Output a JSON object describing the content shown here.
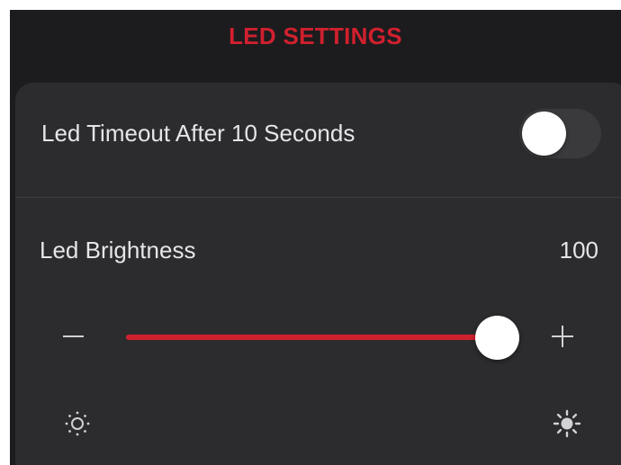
{
  "header": {
    "title": "LED SETTINGS"
  },
  "timeout_setting": {
    "label": "Led Timeout After 10 Seconds",
    "enabled": false
  },
  "brightness_setting": {
    "label": "Led Brightness",
    "value": "100",
    "level_fraction": 1.0,
    "min_icon": "sun-dim-icon",
    "max_icon": "sun-bright-icon",
    "decrease_icon": "minus-icon",
    "increase_icon": "plus-icon"
  },
  "colors": {
    "accent": "#d0202e",
    "background": "#1c1c1e",
    "card": "#2c2c2e"
  }
}
